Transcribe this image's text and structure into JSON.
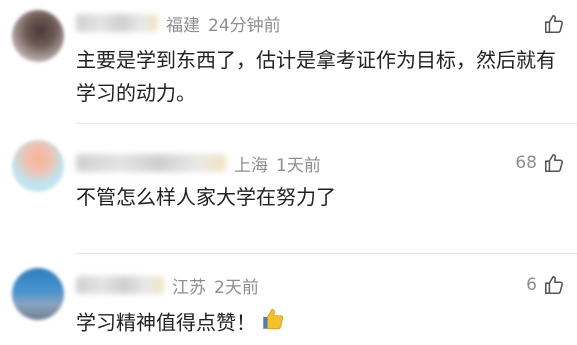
{
  "comments": [
    {
      "location": "福建",
      "time": "24分钟前",
      "likes": "",
      "text": "主要是学到东西了，估计是拿考证作为目标，然后就有学习的动力。"
    },
    {
      "location": "上海",
      "time": "1天前",
      "likes": "68",
      "text": "不管怎么样人家大学在努力了"
    },
    {
      "location": "江苏",
      "time": "2天前",
      "likes": "6",
      "text": "学习精神值得点赞！"
    }
  ],
  "icons": {
    "like": "thumbs-up-outline-icon",
    "emoji": "thumbs-up-emoji-icon"
  },
  "colors": {
    "meta_text": "#8e8e8e",
    "body_text": "#222222",
    "divider": "#e6e6e6"
  }
}
